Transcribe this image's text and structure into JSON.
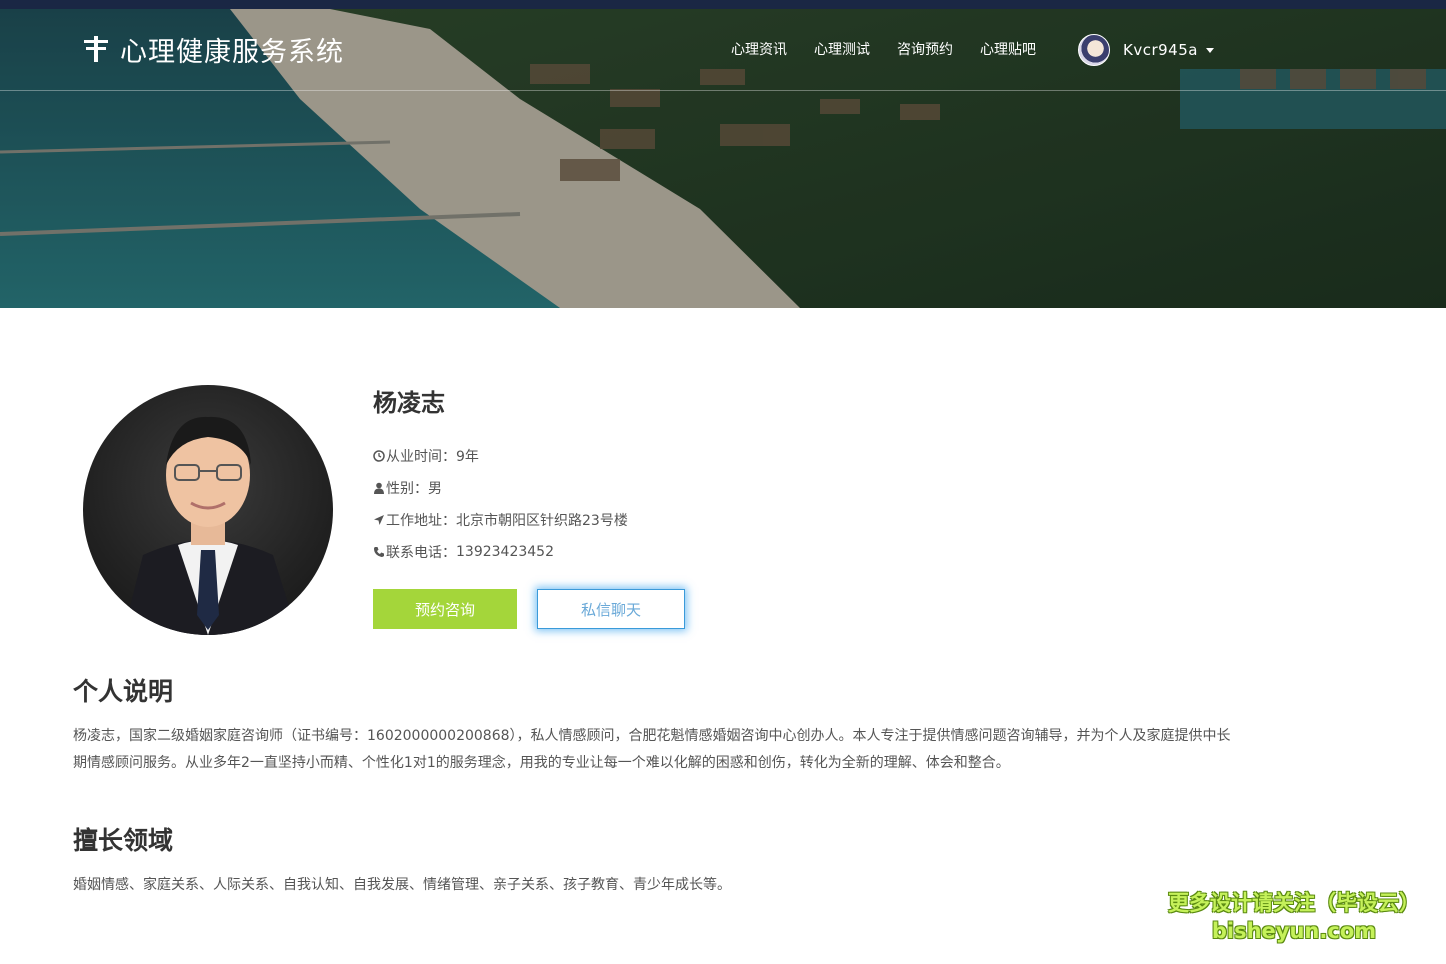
{
  "brand": {
    "title": "心理健康服务系统",
    "icon": "brand-logo-icon"
  },
  "nav": {
    "items": [
      "心理资讯",
      "心理测试",
      "咨询预约",
      "心理贴吧"
    ],
    "user": {
      "name": "Kvcr945a",
      "avatar": "user-avatar"
    }
  },
  "counselor": {
    "name": "杨凌志",
    "experience_label": "从业时间：",
    "experience_value": "9年",
    "gender_label": "性别：",
    "gender_value": "男",
    "address_label": "工作地址：",
    "address_value": "北京市朝阳区针织路23号楼",
    "phone_label": "联系电话：",
    "phone_value": "13923423452"
  },
  "actions": {
    "book": "预约咨询",
    "chat": "私信聊天"
  },
  "about": {
    "title": "个人说明",
    "text": "杨凌志，国家二级婚姻家庭咨询师（证书编号：1602000000200868），私人情感顾问，合肥花魁情感婚姻咨询中心创办人。本人专注于提供情感问题咨询辅导，并为个人及家庭提供中长期情感顾问服务。从业多年2一直坚持小而精、个性化1对1的服务理念，用我的专业让每一个难以化解的困惑和创伤，转化为全新的理解、体会和整合。"
  },
  "specialty": {
    "title": "擅长领域",
    "text": "婚姻情感、家庭关系、人际关系、自我认知、自我发展、情绪管理、亲子关系、孩子教育、青少年成长等。"
  },
  "watermark": {
    "line1": "更多设计请关注（毕设云）",
    "line2": "bisheyun.com"
  },
  "colors": {
    "accent_green": "#a4d63a",
    "chat_blue": "#3a9ad9",
    "topbar": "#1a2744"
  }
}
